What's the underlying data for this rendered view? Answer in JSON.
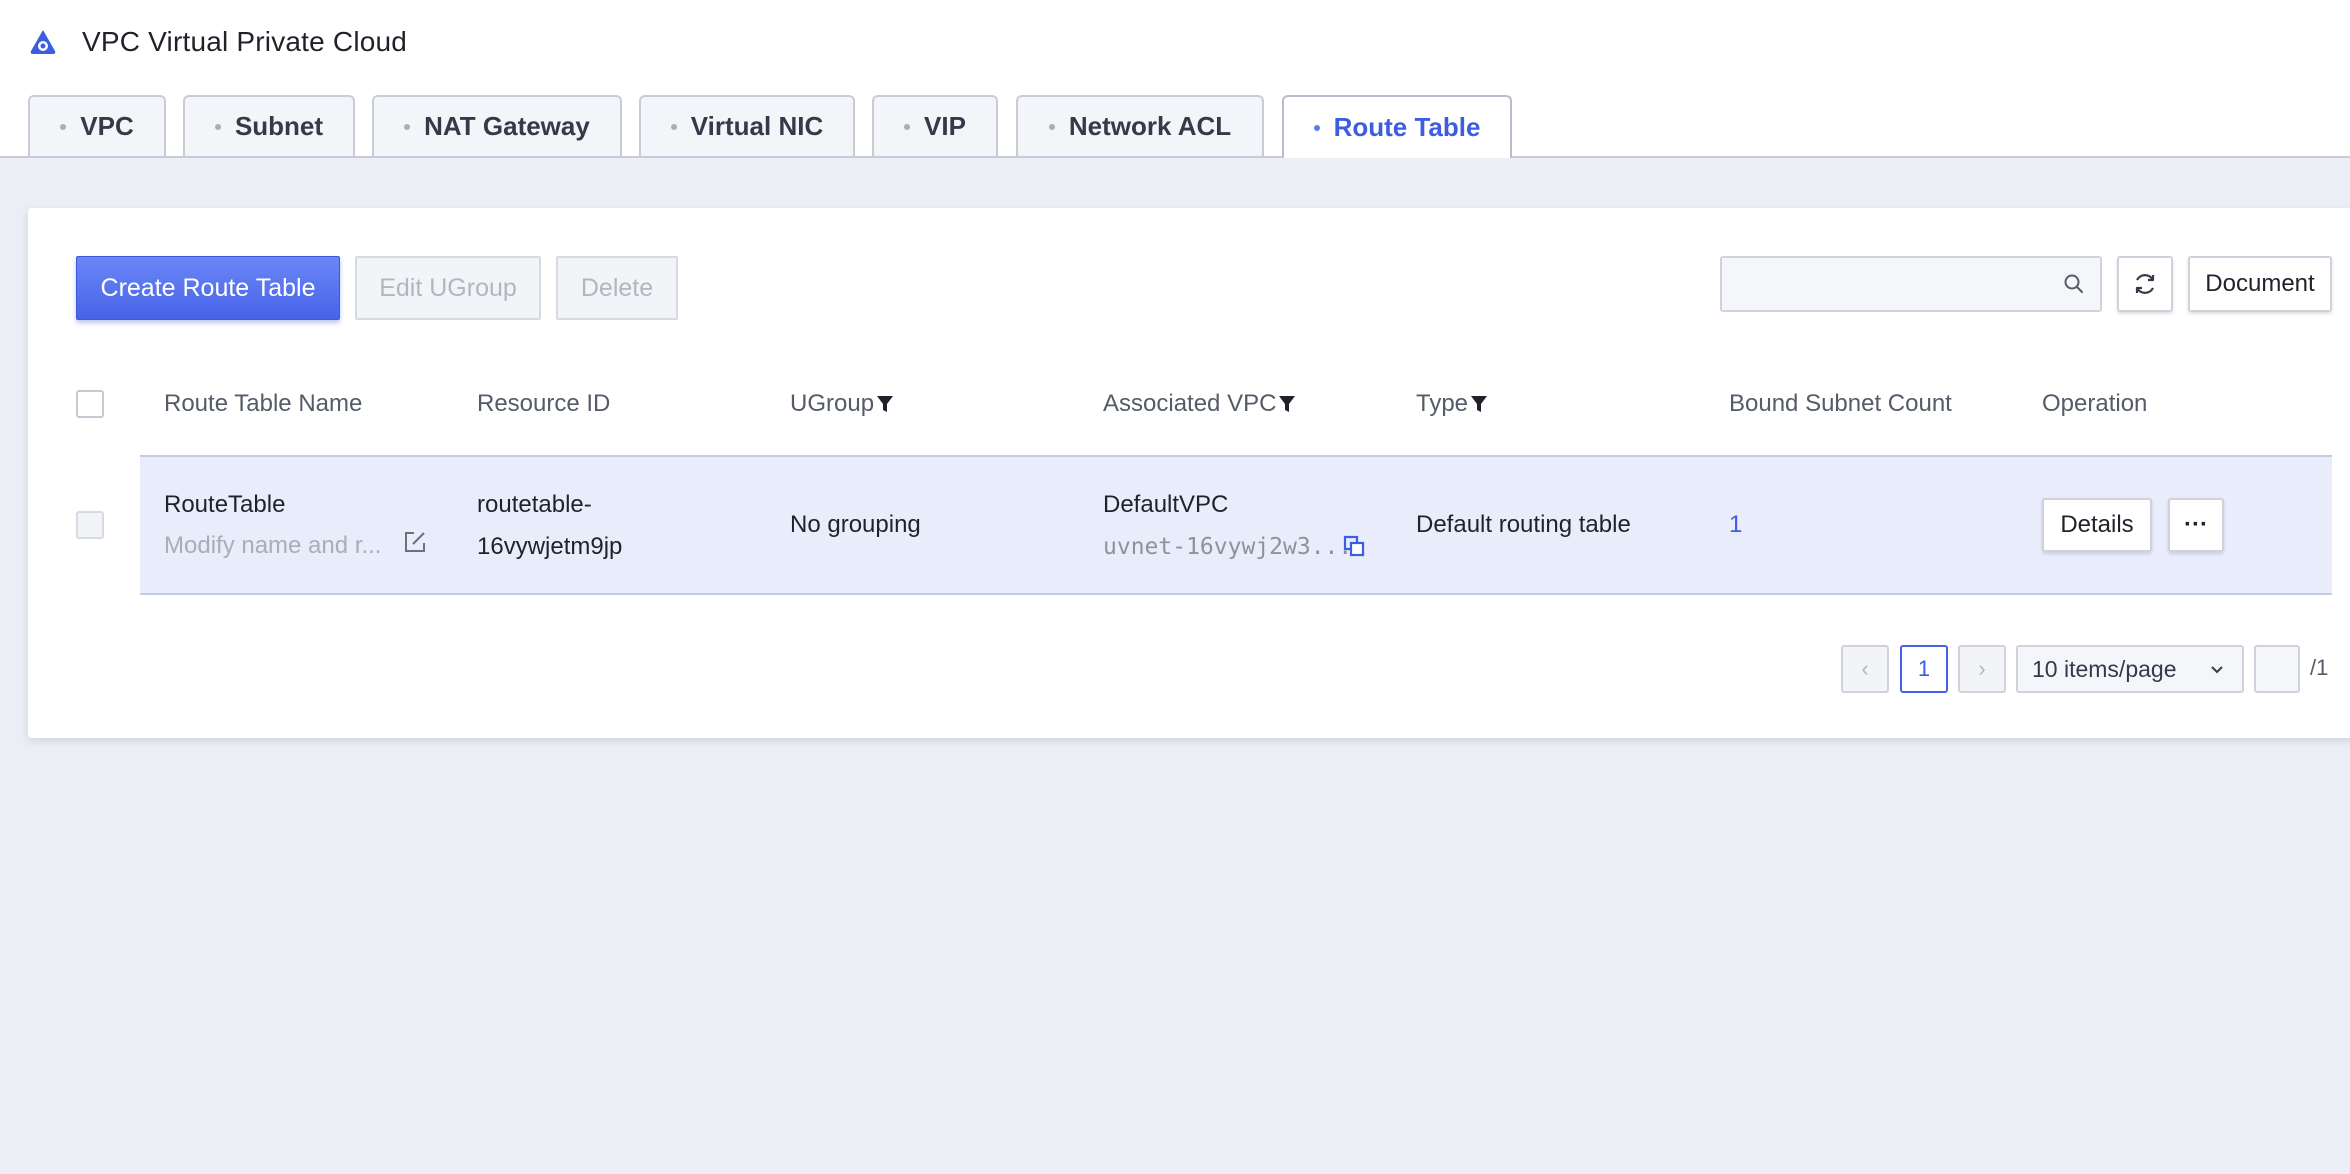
{
  "app": {
    "title": "VPC Virtual Private Cloud",
    "logo_icon": "cloud-logo-icon",
    "accent": "#3d5de0"
  },
  "tabs": [
    {
      "label": "VPC"
    },
    {
      "label": "Subnet"
    },
    {
      "label": "NAT Gateway"
    },
    {
      "label": "Virtual NIC"
    },
    {
      "label": "VIP"
    },
    {
      "label": "Network ACL"
    },
    {
      "label": "Route Table",
      "active": true
    }
  ],
  "toolbar": {
    "create_label": "Create Route Table",
    "edit_label": "Edit UGroup",
    "delete_label": "Delete",
    "search_placeholder": "",
    "refresh_icon": "refresh-icon",
    "document_label": "Document"
  },
  "table": {
    "columns": [
      "Route Table Name",
      "Resource ID",
      "UGroup",
      "Associated VPC",
      "Type",
      "Bound Subnet Count",
      "Operation"
    ],
    "rows": [
      {
        "name": "RouteTable",
        "name_hint": "Modify name and r...",
        "resource_id_line1": "routetable-",
        "resource_id_line2": "16vywjetm9jp",
        "ugroup": "No grouping",
        "vpc_name": "DefaultVPC",
        "vpc_id": "uvnet-16vywj2w3...",
        "type": "Default routing table",
        "subnet_count": "1",
        "details_label": "Details",
        "more_label": "···"
      }
    ]
  },
  "pagination": {
    "prev": "‹",
    "current_page": "1",
    "next": "›",
    "page_size": "10 items/page",
    "total_pages": "/1"
  }
}
